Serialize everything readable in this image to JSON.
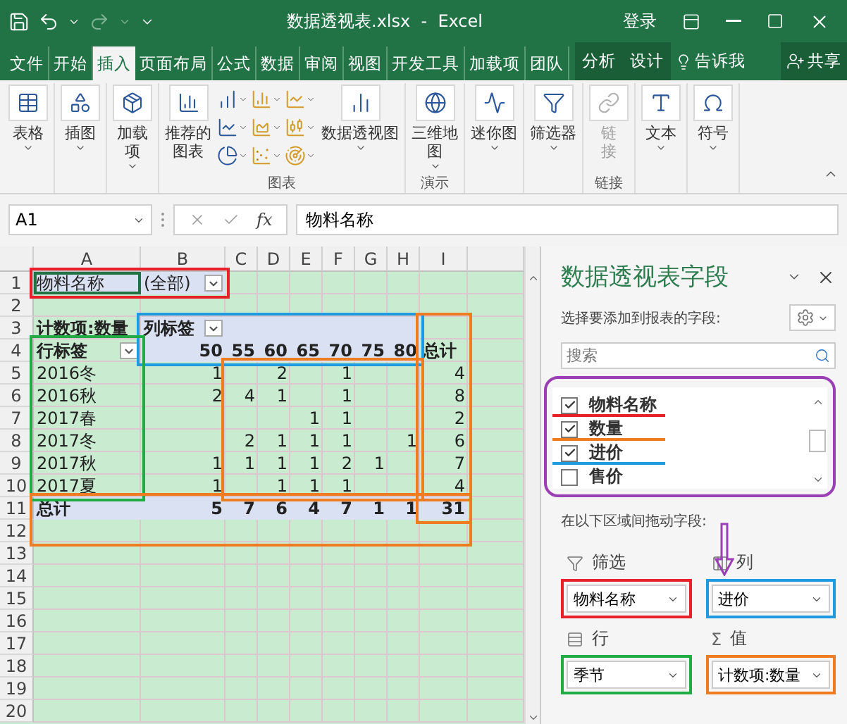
{
  "title_bar": {
    "title": "数据透视表.xlsx  -  Excel",
    "signin": "登录"
  },
  "tabs": [
    {
      "label": "文件",
      "selected": false
    },
    {
      "label": "开始",
      "selected": false
    },
    {
      "label": "插入",
      "selected": true
    },
    {
      "label": "页面布局",
      "selected": false
    },
    {
      "label": "公式",
      "selected": false
    },
    {
      "label": "数据",
      "selected": false
    },
    {
      "label": "审阅",
      "selected": false
    },
    {
      "label": "视图",
      "selected": false
    },
    {
      "label": "开发工具",
      "selected": false
    },
    {
      "label": "加载项",
      "selected": false
    },
    {
      "label": "团队",
      "selected": false
    }
  ],
  "context_tabs": [
    {
      "label": "分析"
    },
    {
      "label": "设计"
    }
  ],
  "tell_me": "告诉我",
  "share": "共享",
  "ribbon": [
    {
      "buttons": [
        {
          "kind": "large",
          "lines": [
            "表格"
          ],
          "dropdown": true,
          "disabled": false
        }
      ]
    },
    {
      "buttons": [
        {
          "kind": "large",
          "lines": [
            "插图"
          ],
          "dropdown": true,
          "disabled": false
        }
      ]
    },
    {
      "buttons": [
        {
          "kind": "large",
          "lines": [
            "加载",
            "项"
          ],
          "dropdown": true,
          "disabled": false
        }
      ]
    },
    {
      "label": "图表",
      "buttons": [
        {
          "kind": "large",
          "lines": [
            "推荐的",
            "图表"
          ],
          "dropdown": false,
          "disabled": false
        },
        {
          "kind": "gallery"
        },
        {
          "kind": "large",
          "lines": [
            "数据透视图"
          ],
          "dropdown": true,
          "disabled": false
        }
      ]
    },
    {
      "label": "演示",
      "buttons": [
        {
          "kind": "large",
          "lines": [
            "三维地",
            "图"
          ],
          "dropdown": true,
          "disabled": false
        }
      ]
    },
    {
      "buttons": [
        {
          "kind": "large",
          "lines": [
            "迷你图"
          ],
          "dropdown": true,
          "disabled": false
        }
      ]
    },
    {
      "buttons": [
        {
          "kind": "large",
          "lines": [
            "筛选器"
          ],
          "dropdown": true,
          "disabled": false
        }
      ]
    },
    {
      "label": "链接",
      "buttons": [
        {
          "kind": "large",
          "lines": [
            "链",
            "接"
          ],
          "dropdown": false,
          "disabled": true
        }
      ]
    },
    {
      "buttons": [
        {
          "kind": "large",
          "lines": [
            "文本"
          ],
          "dropdown": true,
          "disabled": false
        }
      ]
    },
    {
      "buttons": [
        {
          "kind": "large",
          "lines": [
            "符号"
          ],
          "dropdown": true,
          "disabled": false
        }
      ]
    }
  ],
  "formula_bar": {
    "name_box": "A1",
    "fx": "fx",
    "formula": "物料名称"
  },
  "sheet": {
    "columns": [
      "A",
      "B",
      "C",
      "D",
      "E",
      "F",
      "G",
      "H",
      "I"
    ],
    "rows": [
      "1",
      "2",
      "3",
      "4",
      "5",
      "6",
      "7",
      "8",
      "9",
      "10",
      "11",
      "12",
      "13",
      "14",
      "15",
      "16",
      "17",
      "18",
      "19",
      "20"
    ]
  },
  "pivot": {
    "filter": {
      "field": "物料名称",
      "value": "(全部)"
    },
    "value_caption": "计数项:数量",
    "column_caption": "列标签",
    "row_caption": "行标签",
    "columns": [
      "50",
      "55",
      "60",
      "65",
      "70",
      "75",
      "80"
    ],
    "total_label": "总计",
    "rows": [
      {
        "label": "2016冬",
        "values": [
          {
            "count": "1"
          },
          {
            "empty": true
          },
          {
            "count": "2"
          },
          {
            "empty": true
          },
          {
            "count": "1"
          },
          {
            "empty": true
          },
          {
            "empty": true
          }
        ],
        "total": "4"
      },
      {
        "label": "2016秋",
        "values": [
          {
            "count": "2"
          },
          {
            "count": "4"
          },
          {
            "count": "1"
          },
          {
            "empty": true
          },
          {
            "count": "1"
          },
          {
            "empty": true
          },
          {
            "empty": true
          }
        ],
        "total": "8"
      },
      {
        "label": "2017春",
        "values": [
          {
            "empty": true
          },
          {
            "empty": true
          },
          {
            "empty": true
          },
          {
            "count": "1"
          },
          {
            "count": "1"
          },
          {
            "empty": true
          },
          {
            "empty": true
          }
        ],
        "total": "2"
      },
      {
        "label": "2017冬",
        "values": [
          {
            "empty": true
          },
          {
            "count": "2"
          },
          {
            "count": "1"
          },
          {
            "count": "1"
          },
          {
            "count": "1"
          },
          {
            "empty": true
          },
          {
            "count": "1"
          }
        ],
        "total": "6"
      },
      {
        "label": "2017秋",
        "values": [
          {
            "count": "1"
          },
          {
            "count": "1"
          },
          {
            "count": "1"
          },
          {
            "count": "1"
          },
          {
            "count": "2"
          },
          {
            "count": "1"
          },
          {
            "empty": true
          }
        ],
        "total": "7"
      },
      {
        "label": "2017夏",
        "values": [
          {
            "count": "1"
          },
          {
            "empty": true
          },
          {
            "count": "1"
          },
          {
            "count": "1"
          },
          {
            "count": "1"
          },
          {
            "empty": true
          },
          {
            "empty": true
          }
        ],
        "total": "4"
      }
    ],
    "grand_total": {
      "label": "总计",
      "values": [
        {
          "count": "5"
        },
        {
          "count": "7"
        },
        {
          "count": "6"
        },
        {
          "count": "4"
        },
        {
          "count": "7"
        },
        {
          "count": "1"
        },
        {
          "count": "1"
        }
      ],
      "total": "31"
    }
  },
  "annotation_frames": [
    {
      "kind": "filter",
      "color": "#e8202a"
    },
    {
      "kind": "column_labels",
      "color": "#1e9be0"
    },
    {
      "kind": "row_labels",
      "color": "#22aa44"
    },
    {
      "kind": "values",
      "color": "#f07c22"
    },
    {
      "kind": "row_totals",
      "color": "#f07c22"
    },
    {
      "kind": "grand_total_row",
      "color": "#f07c22"
    },
    {
      "kind": "grand_total",
      "color": "#f07c22"
    }
  ],
  "field_panel": {
    "title": "数据透视表字段",
    "prompt": "选择要添加到报表的字段:",
    "search": {
      "placeholder": "搜索"
    },
    "list_frame": {
      "color": "#9b3fb5"
    },
    "fields": [
      {
        "name": "物料名称",
        "checked": true,
        "color": "#e8202a"
      },
      {
        "name": "数量",
        "checked": true,
        "color": "#f07c22"
      },
      {
        "name": "进价",
        "checked": true,
        "color": "#1e9be0"
      },
      {
        "name": "售价",
        "checked": false
      }
    ],
    "drag_prompt": "在以下区域间拖动字段:",
    "areas": [
      {
        "kind": "filter",
        "label": "筛选",
        "field": "物料名称",
        "color": "#e8202a"
      },
      {
        "kind": "columns",
        "label": "列",
        "field": "进价",
        "color": "#1e9be0"
      },
      {
        "kind": "rows",
        "label": "行",
        "field": "季节",
        "color": "#22aa44"
      },
      {
        "kind": "values",
        "label": "值",
        "symbol": "Σ",
        "field": "计数项:数量",
        "color": "#f07c22"
      }
    ]
  }
}
